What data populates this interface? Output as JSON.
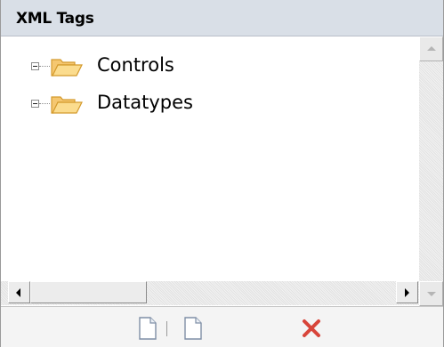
{
  "panel": {
    "title": "XML Tags"
  },
  "tree": {
    "items": [
      {
        "label": "Controls",
        "expander": "minus",
        "icon": "folder-open-icon"
      },
      {
        "label": "Datatypes",
        "expander": "minus",
        "icon": "folder-open-icon"
      }
    ]
  },
  "toolbar": {
    "buttons": [
      {
        "name": "new-document-button",
        "icon": "document-icon"
      },
      {
        "name": "new-document-button-2",
        "icon": "document-icon"
      },
      {
        "name": "delete-button",
        "icon": "red-x-icon"
      }
    ]
  },
  "colors": {
    "header_bg": "#d9dfe7",
    "folder_fill": "#f5c770",
    "folder_stroke": "#d49a2c",
    "delete_red": "#d8453a"
  }
}
